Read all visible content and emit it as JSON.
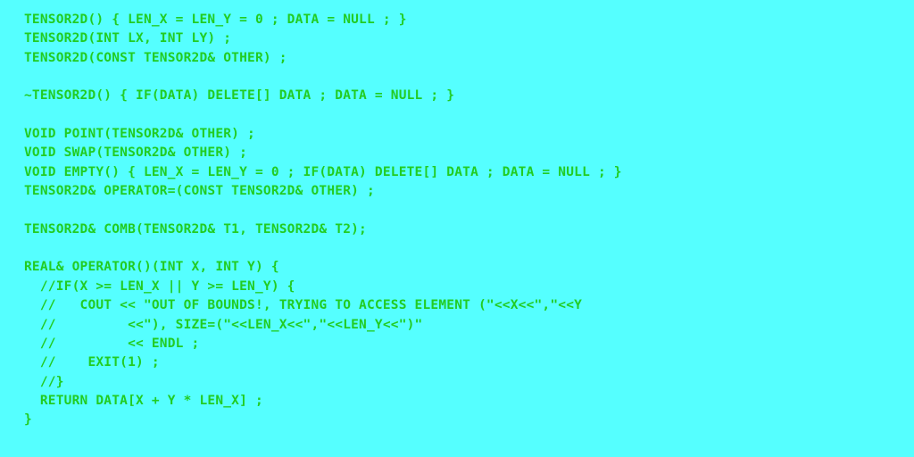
{
  "code": {
    "lines": [
      "TENSOR2D() { LEN_X = LEN_Y = 0 ; DATA = NULL ; }",
      "TENSOR2D(INT LX, INT LY) ;",
      "TENSOR2D(CONST TENSOR2D& OTHER) ;",
      "",
      "~TENSOR2D() { IF(DATA) DELETE[] DATA ; DATA = NULL ; }",
      "",
      "VOID POINT(TENSOR2D& OTHER) ;",
      "VOID SWAP(TENSOR2D& OTHER) ;",
      "VOID EMPTY() { LEN_X = LEN_Y = 0 ; IF(DATA) DELETE[] DATA ; DATA = NULL ; }",
      "TENSOR2D& OPERATOR=(CONST TENSOR2D& OTHER) ;",
      "",
      "TENSOR2D& COMB(TENSOR2D& T1, TENSOR2D& T2);",
      "",
      "REAL& OPERATOR()(INT X, INT Y) {",
      "  //IF(X >= LEN_X || Y >= LEN_Y) {",
      "  //   COUT << \"OUT OF BOUNDS!, TRYING TO ACCESS ELEMENT (\"<<X<<\",\"<<Y",
      "  //         <<\"), SIZE=(\"<<LEN_X<<\",\"<<LEN_Y<<\")\"",
      "  //         << ENDL ;",
      "  //    EXIT(1) ;",
      "  //}",
      "  RETURN DATA[X + Y * LEN_X] ;",
      "}"
    ]
  },
  "colors": {
    "background": "#55ffff",
    "text": "#22cc22"
  }
}
